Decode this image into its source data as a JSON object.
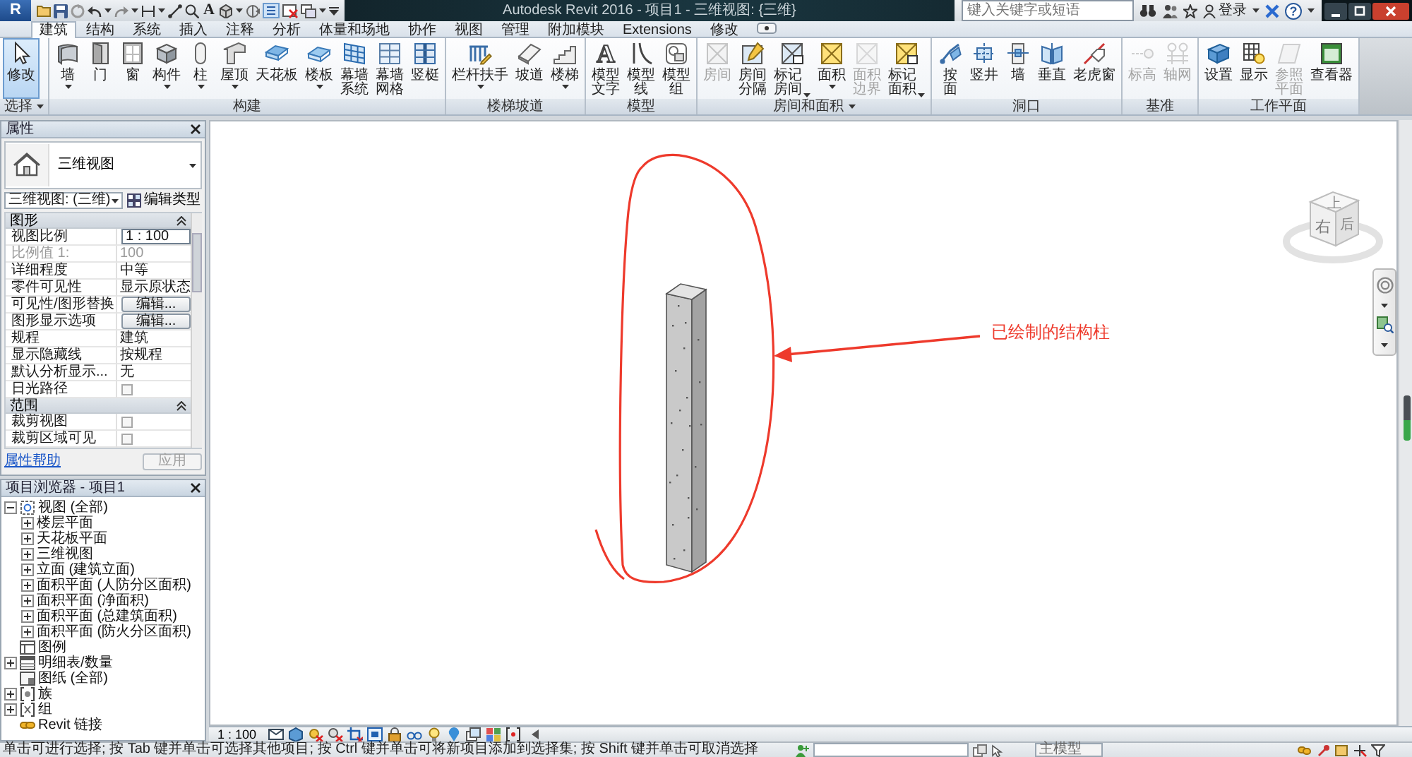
{
  "title_bar": {
    "logo_glyph": "R",
    "text_tool_glyph": "A",
    "title": "Autodesk Revit 2016 - 项目1 - 三维视图: {三维}",
    "search": {
      "placeholder": "键入关键字或短语"
    },
    "sign_in": "登录",
    "help_glyph": "?"
  },
  "tabs": [
    {
      "label": "建筑",
      "selected": true
    },
    {
      "label": "结构",
      "selected": false
    },
    {
      "label": "系统",
      "selected": false
    },
    {
      "label": "插入",
      "selected": false
    },
    {
      "label": "注释",
      "selected": false
    },
    {
      "label": "分析",
      "selected": false
    },
    {
      "label": "体量和场地",
      "selected": false
    },
    {
      "label": "协作",
      "selected": false
    },
    {
      "label": "视图",
      "selected": false
    },
    {
      "label": "管理",
      "selected": false
    },
    {
      "label": "附加模块",
      "selected": false
    },
    {
      "label": "Extensions",
      "selected": false
    },
    {
      "label": "修改",
      "selected": false
    }
  ],
  "ribbon": {
    "panels": [
      {
        "title": "选择",
        "has_menu": true,
        "buttons": [
          {
            "label": "修改",
            "kind": "single",
            "selected": true,
            "disabled": false,
            "dropdown": false
          }
        ]
      },
      {
        "title": "构建",
        "has_menu": false,
        "buttons": [
          {
            "label": "墙",
            "kind": "single",
            "disabled": false,
            "dropdown": true
          },
          {
            "label": "门",
            "kind": "single",
            "disabled": false,
            "dropdown": false
          },
          {
            "label": "窗",
            "kind": "single",
            "disabled": false,
            "dropdown": false
          },
          {
            "label": "构件",
            "kind": "single",
            "disabled": false,
            "dropdown": true
          },
          {
            "label": "柱",
            "kind": "single",
            "disabled": false,
            "dropdown": true
          },
          {
            "label": "屋顶",
            "kind": "single",
            "disabled": false,
            "dropdown": true
          },
          {
            "label": "天花板",
            "kind": "single",
            "disabled": false,
            "dropdown": false
          },
          {
            "label": "楼板",
            "kind": "single",
            "disabled": false,
            "dropdown": true
          },
          {
            "label": "幕墙系统",
            "kind": "wrapped",
            "disabled": false,
            "dropdown": false
          },
          {
            "label": "幕墙网格",
            "kind": "wrapped",
            "disabled": false,
            "dropdown": false
          },
          {
            "label": "竖梃",
            "kind": "single",
            "disabled": false,
            "dropdown": false
          }
        ]
      },
      {
        "title": "楼梯坡道",
        "has_menu": false,
        "buttons": [
          {
            "label": "栏杆扶手",
            "kind": "single",
            "disabled": false,
            "dropdown": true
          },
          {
            "label": "坡道",
            "kind": "single",
            "disabled": false,
            "dropdown": false
          },
          {
            "label": "楼梯",
            "kind": "single",
            "disabled": false,
            "dropdown": true
          }
        ]
      },
      {
        "title": "模型",
        "has_menu": false,
        "buttons": [
          {
            "label": "模型文字",
            "kind": "wrapped",
            "glyph": "A",
            "disabled": false,
            "dropdown": false
          },
          {
            "label": "模型线",
            "kind": "wrapped",
            "disabled": false,
            "dropdown": false
          },
          {
            "label": "模型组",
            "kind": "wrapped",
            "disabled": false,
            "dropdown": false
          }
        ]
      },
      {
        "title": "房间和面积",
        "has_menu": true,
        "buttons": [
          {
            "label": "房间",
            "kind": "single",
            "disabled": true,
            "dropdown": false
          },
          {
            "label": "房间分隔",
            "kind": "wrapped",
            "disabled": false,
            "dropdown": false
          },
          {
            "label": "标记房间",
            "kind": "wrapped",
            "disabled": false,
            "dropdown": true
          },
          {
            "label": "面积",
            "kind": "single",
            "disabled": false,
            "dropdown": true
          },
          {
            "label": "面积边界",
            "kind": "wrapped",
            "disabled": true,
            "dropdown": false
          },
          {
            "label": "标记面积",
            "kind": "wrapped",
            "disabled": false,
            "dropdown": true
          }
        ]
      },
      {
        "title": "洞口",
        "has_menu": false,
        "buttons": [
          {
            "label": "按面",
            "kind": "wrapped",
            "disabled": false,
            "dropdown": false
          },
          {
            "label": "竖井",
            "kind": "single",
            "disabled": false,
            "dropdown": false
          },
          {
            "label": "墙",
            "kind": "single",
            "disabled": false,
            "dropdown": false
          },
          {
            "label": "垂直",
            "kind": "single",
            "disabled": false,
            "dropdown": false
          },
          {
            "label": "老虎窗",
            "kind": "single",
            "disabled": false,
            "dropdown": false
          }
        ]
      },
      {
        "title": "基准",
        "has_menu": false,
        "buttons": [
          {
            "label": "标高",
            "kind": "single",
            "disabled": true,
            "dropdown": false
          },
          {
            "label": "轴网",
            "kind": "single",
            "disabled": true,
            "dropdown": false
          }
        ]
      },
      {
        "title": "工作平面",
        "has_menu": false,
        "buttons": [
          {
            "label": "设置",
            "kind": "single",
            "disabled": false,
            "dropdown": false
          },
          {
            "label": "显示",
            "kind": "single",
            "disabled": false,
            "dropdown": false
          },
          {
            "label": "参照平面",
            "kind": "wrapped",
            "disabled": true,
            "dropdown": false
          },
          {
            "label": "查看器",
            "kind": "single",
            "disabled": false,
            "dropdown": false
          }
        ]
      }
    ]
  },
  "properties": {
    "title": "属性",
    "type_name": "三维视图",
    "view_selector": "三维视图: (三维)",
    "edit_type": "编辑类型",
    "groups": [
      {
        "name": "图形",
        "rows": [
          {
            "label": "视图比例",
            "kind": "input",
            "value": "1 : 100",
            "disabled": false
          },
          {
            "label": "比例值 1:",
            "kind": "text",
            "value": "100",
            "disabled": true
          },
          {
            "label": "详细程度",
            "kind": "text",
            "value": "中等",
            "disabled": false
          },
          {
            "label": "零件可见性",
            "kind": "text",
            "value": "显示原状态",
            "disabled": false
          },
          {
            "label": "可见性/图形替换",
            "kind": "button",
            "value": "编辑...",
            "disabled": false
          },
          {
            "label": "图形显示选项",
            "kind": "button",
            "value": "编辑...",
            "disabled": false
          },
          {
            "label": "规程",
            "kind": "text",
            "value": "建筑",
            "disabled": false
          },
          {
            "label": "显示隐藏线",
            "kind": "text",
            "value": "按规程",
            "disabled": false
          },
          {
            "label": "默认分析显示...",
            "kind": "text",
            "value": "无",
            "disabled": false
          },
          {
            "label": "日光路径",
            "kind": "checkbox",
            "checked": false,
            "disabled": false
          }
        ]
      },
      {
        "name": "范围",
        "rows": [
          {
            "label": "裁剪视图",
            "kind": "checkbox",
            "checked": false,
            "disabled": false
          },
          {
            "label": "裁剪区域可见",
            "kind": "checkbox",
            "checked": false,
            "disabled": false
          }
        ]
      }
    ],
    "help_link": "属性帮助",
    "apply": {
      "label": "应用",
      "disabled": true
    }
  },
  "browser": {
    "title": "项目浏览器 - 项目1",
    "items": [
      {
        "label": "视图 (全部)",
        "expanded": true,
        "children": [
          {
            "label": "楼层平面",
            "expanded": false
          },
          {
            "label": "天花板平面",
            "expanded": false
          },
          {
            "label": "三维视图",
            "expanded": false
          },
          {
            "label": "立面 (建筑立面)",
            "expanded": false
          },
          {
            "label": "面积平面 (人防分区面积)",
            "expanded": false
          },
          {
            "label": "面积平面 (净面积)",
            "expanded": false
          },
          {
            "label": "面积平面 (总建筑面积)",
            "expanded": false
          },
          {
            "label": "面积平面 (防火分区面积)",
            "expanded": false
          }
        ]
      },
      {
        "label": "图例"
      },
      {
        "label": "明细表/数量",
        "expanded": false
      },
      {
        "label": "图纸 (全部)"
      },
      {
        "label": "族",
        "expanded": false
      },
      {
        "label": "组",
        "expanded": false
      },
      {
        "label": "Revit 链接"
      }
    ]
  },
  "canvas": {
    "annotation": "已绘制的结构柱",
    "view_cube": {
      "top": "上",
      "left": "右",
      "right": "后"
    }
  },
  "view_bar": {
    "scale": "1 : 100"
  },
  "status_bar": {
    "message": "单击可进行选择; 按 Tab 键并单击可选择其他项目; 按 Ctrl 键并单击可将新项目添加到选择集; 按 Shift 键并单击可取消选择",
    "model": "主模型"
  }
}
